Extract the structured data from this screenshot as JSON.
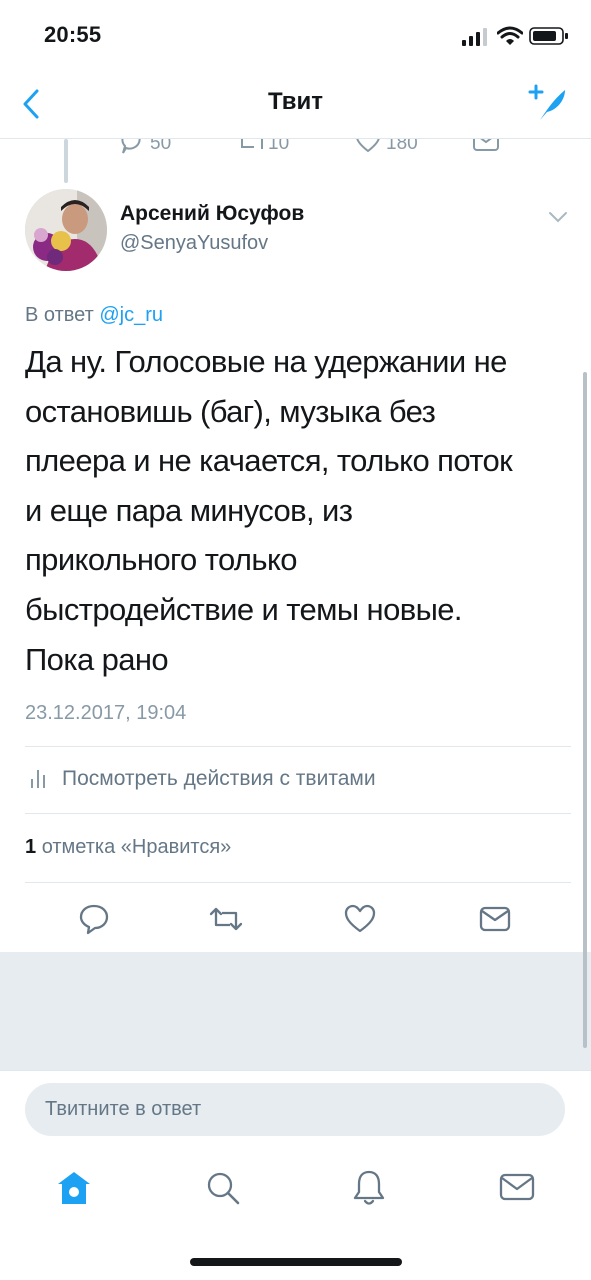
{
  "status_bar": {
    "time": "20:55"
  },
  "nav": {
    "title": "Твит"
  },
  "prev_tweet": {
    "replies": "50",
    "retweets": "10",
    "likes": "180"
  },
  "tweet": {
    "author_name": "Арсений Юсуфов",
    "author_handle": "@SenyaYusufov",
    "reply_label": "В ответ",
    "reply_mention": "@jc_ru",
    "lines": [
      "Да ну. Голосовые на удержании не",
      "остановишь (баг), музыка без",
      "плеера и не качается, только поток",
      "и еще пара минусов, из",
      "прикольного только",
      "быстродействие и темы новые.",
      "Пока рано"
    ],
    "timestamp": "23.12.2017, 19:04",
    "activity_label": "Посмотреть действия с твитами",
    "likes_count": "1",
    "likes_label": "отметка «Нравится»"
  },
  "reply": {
    "placeholder": "Твитните в ответ"
  },
  "colors": {
    "accent": "#1da1f2",
    "secondary_text": "#657786",
    "divider": "#e1e8ed"
  },
  "tab_bar": {
    "tabs": [
      "home-icon",
      "search-icon",
      "notifications-icon",
      "messages-icon"
    ]
  }
}
